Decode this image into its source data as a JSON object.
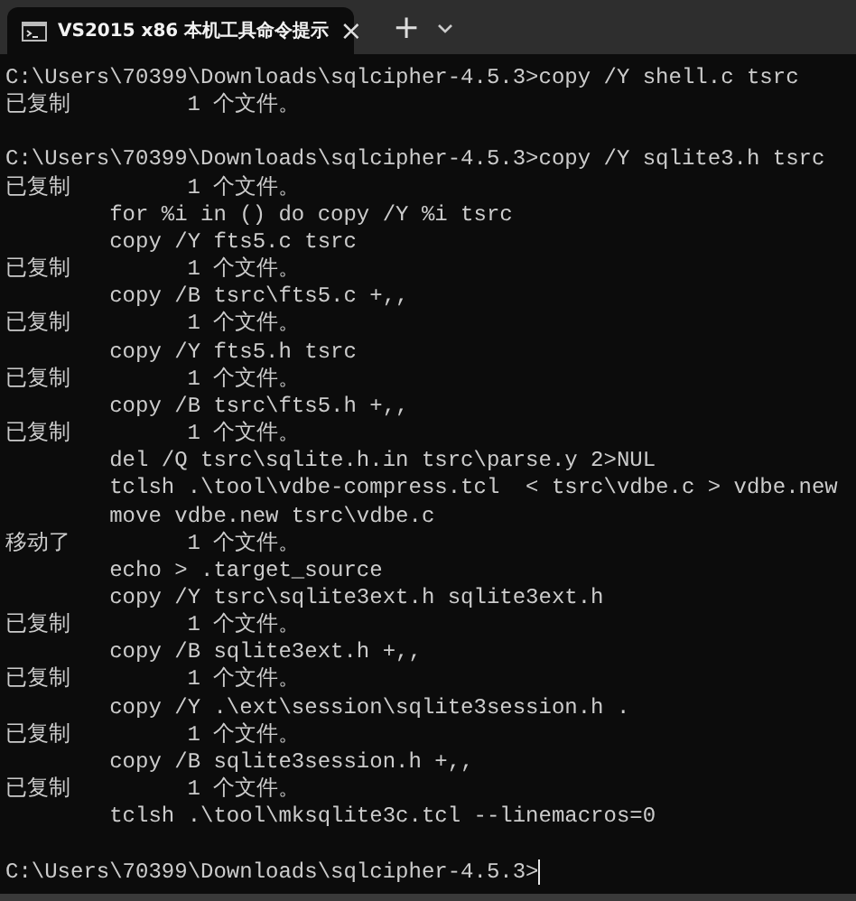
{
  "tabs": [
    {
      "title": "VS2015 x86 本机工具命令提示",
      "selected": true,
      "close": "×"
    }
  ],
  "new_tab": "+",
  "blocks": [
    {
      "lines": [
        {
          "text": "C:\\Users\\70399\\Downloads\\sqlcipher-4.5.3>copy /Y shell.c tsrc"
        },
        {
          "text": "已复制         1 个文件。"
        }
      ]
    },
    {
      "lines": [
        {
          "text": "C:\\Users\\70399\\Downloads\\sqlcipher-4.5.3>copy /Y sqlite3.h tsrc"
        },
        {
          "text": "已复制         1 个文件。"
        },
        {
          "text": "        for %i in () do copy /Y %i tsrc"
        },
        {
          "text": "        copy /Y fts5.c tsrc"
        },
        {
          "text": "已复制         1 个文件。"
        },
        {
          "text": "        copy /B tsrc\\fts5.c +,,"
        },
        {
          "text": "已复制         1 个文件。"
        },
        {
          "text": "        copy /Y fts5.h tsrc"
        },
        {
          "text": "已复制         1 个文件。"
        },
        {
          "text": "        copy /B tsrc\\fts5.h +,,"
        },
        {
          "text": "已复制         1 个文件。"
        },
        {
          "text": "        del /Q tsrc\\sqlite.h.in tsrc\\parse.y 2>NUL"
        },
        {
          "text": "        tclsh .\\tool\\vdbe-compress.tcl  < tsrc\\vdbe.c > vdbe.new"
        },
        {
          "text": "        move vdbe.new tsrc\\vdbe.c"
        },
        {
          "text": "移动了         1 个文件。"
        },
        {
          "text": "        echo > .target_source"
        },
        {
          "text": "        copy /Y tsrc\\sqlite3ext.h sqlite3ext.h"
        },
        {
          "text": "已复制         1 个文件。"
        },
        {
          "text": "        copy /B sqlite3ext.h +,,"
        },
        {
          "text": "已复制         1 个文件。"
        },
        {
          "text": "        copy /Y .\\ext\\session\\sqlite3session.h ."
        },
        {
          "text": "已复制         1 个文件。"
        },
        {
          "text": "        copy /B sqlite3session.h +,,"
        },
        {
          "text": "已复制         1 个文件。"
        },
        {
          "text": "        tclsh .\\tool\\mksqlite3c.tcl --linemacros=0"
        }
      ]
    },
    {
      "lines": [
        {
          "text": "C:\\Users\\70399\\Downloads\\sqlcipher-4.5.3>",
          "cursor": true
        }
      ]
    }
  ]
}
